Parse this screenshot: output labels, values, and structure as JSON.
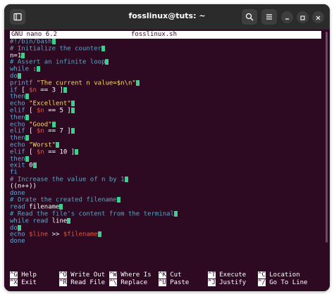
{
  "window": {
    "title": "fosslinux@tuts: ~"
  },
  "titlebar": {
    "icons": [
      "terminal-tab-icon",
      "search-icon",
      "menu-icon",
      "minimize-icon",
      "maximize-icon",
      "close-icon"
    ]
  },
  "nano": {
    "version": "GNU nano 6.2",
    "filename": "fosslinux.sh"
  },
  "code_lines": [
    [
      {
        "t": "#!/bin/bash",
        "c": "shebang"
      }
    ],
    [
      {
        "t": "# Initialize the counter",
        "c": "comment"
      }
    ],
    [
      {
        "t": "n=1",
        "c": "plain"
      }
    ],
    [
      {
        "t": "# Assert an infinite loop",
        "c": "comment"
      }
    ],
    [
      {
        "t": "while",
        "c": "kw"
      },
      {
        "t": " :",
        "c": "plain"
      }
    ],
    [
      {
        "t": "do",
        "c": "kw"
      }
    ],
    [
      {
        "t": "printf",
        "c": "kw"
      },
      {
        "t": " \"The current n value=$n\\n\"",
        "c": "str"
      }
    ],
    [
      {
        "t": "if",
        "c": "kw"
      },
      {
        "t": " [ ",
        "c": "plain"
      },
      {
        "t": "$n",
        "c": "var"
      },
      {
        "t": " == 3 ]",
        "c": "plain"
      }
    ],
    [
      {
        "t": "then",
        "c": "kw"
      }
    ],
    [
      {
        "t": "echo",
        "c": "kw"
      },
      {
        "t": " \"Excellent\"",
        "c": "str"
      }
    ],
    [
      {
        "t": "elif",
        "c": "kw"
      },
      {
        "t": " [ ",
        "c": "plain"
      },
      {
        "t": "$n",
        "c": "var"
      },
      {
        "t": " == 5 ]",
        "c": "plain"
      }
    ],
    [
      {
        "t": "then",
        "c": "kw"
      }
    ],
    [
      {
        "t": "echo",
        "c": "kw"
      },
      {
        "t": " \"Good\"",
        "c": "str"
      }
    ],
    [
      {
        "t": "elif",
        "c": "kw"
      },
      {
        "t": " [ ",
        "c": "plain"
      },
      {
        "t": "$n",
        "c": "var"
      },
      {
        "t": " == 7 ]",
        "c": "plain"
      }
    ],
    [
      {
        "t": "then",
        "c": "kw"
      }
    ],
    [
      {
        "t": "echo",
        "c": "kw"
      },
      {
        "t": " \"Worst\"",
        "c": "str"
      }
    ],
    [
      {
        "t": "elif",
        "c": "kw"
      },
      {
        "t": " [ ",
        "c": "plain"
      },
      {
        "t": "$n",
        "c": "var"
      },
      {
        "t": " == 10 ]",
        "c": "plain"
      }
    ],
    [
      {
        "t": "then",
        "c": "kw"
      }
    ],
    [
      {
        "t": "exit",
        "c": "kw"
      },
      {
        "t": " 0",
        "c": "plain"
      }
    ],
    [
      {
        "t": "fi",
        "c": "kw"
      }
    ],
    [
      {
        "t": "# Increase the value of n by 1",
        "c": "comment"
      }
    ],
    [
      {
        "t": "((n++))",
        "c": "plain"
      }
    ],
    [
      {
        "t": "done",
        "c": "kw"
      }
    ],
    [
      {
        "t": "# Orate the created filename",
        "c": "comment"
      }
    ],
    [
      {
        "t": "read",
        "c": "kw"
      },
      {
        "t": " filename",
        "c": "plain"
      }
    ],
    [
      {
        "t": "# Read the file's content from the terminal",
        "c": "comment"
      }
    ],
    [
      {
        "t": "while",
        "c": "kw"
      },
      {
        "t": " read",
        "c": "kw"
      },
      {
        "t": " line",
        "c": "plain"
      }
    ],
    [
      {
        "t": "do",
        "c": "kw"
      }
    ],
    [
      {
        "t": "echo",
        "c": "kw"
      },
      {
        "t": " $line",
        "c": "var"
      },
      {
        "t": " >> ",
        "c": "plain"
      },
      {
        "t": "$filename",
        "c": "var"
      }
    ],
    [
      {
        "t": "done",
        "c": "kw"
      }
    ]
  ],
  "cursor_lines": [
    0,
    1,
    2,
    3,
    4,
    5,
    6,
    7,
    8,
    9,
    10,
    11,
    12,
    13,
    14,
    15,
    16,
    17,
    18,
    20,
    23,
    24,
    25,
    26,
    27,
    28
  ],
  "shortcuts": [
    {
      "key": "^G",
      "label": "Help"
    },
    {
      "key": "^X",
      "label": "Exit"
    },
    {
      "key": "^O",
      "label": "Write Out"
    },
    {
      "key": "^R",
      "label": "Read File"
    },
    {
      "key": "^W",
      "label": "Where Is"
    },
    {
      "key": "^\\",
      "label": "Replace"
    },
    {
      "key": "^K",
      "label": "Cut"
    },
    {
      "key": "^U",
      "label": "Paste"
    },
    {
      "key": "^T",
      "label": "Execute"
    },
    {
      "key": "^J",
      "label": "Justify"
    },
    {
      "key": "^C",
      "label": "Location"
    },
    {
      "key": "^/",
      "label": "Go To Line"
    }
  ],
  "colors": {
    "terminal_bg": "#2d0a22",
    "comment": "#58a6c8",
    "keyword": "#5fa8d8",
    "string": "#ffd75f",
    "variable": "#e0573f",
    "cursor": "#3ecf8e"
  }
}
